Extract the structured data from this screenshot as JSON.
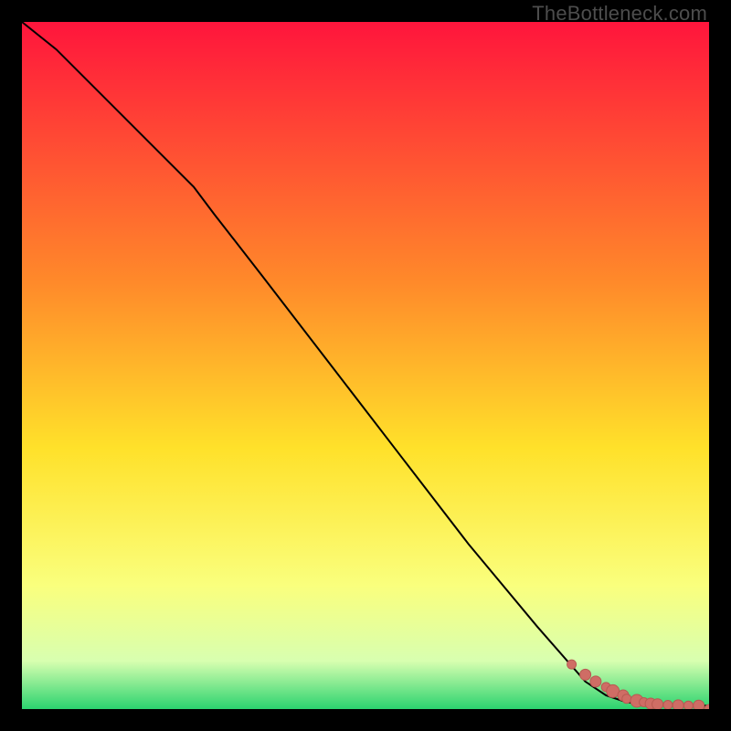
{
  "watermark": "TheBottleneck.com",
  "colors": {
    "bg": "#000000",
    "grad_top": "#ff153c",
    "grad_mid1": "#ff8a2a",
    "grad_mid2": "#ffe12a",
    "grad_mid3": "#faff7d",
    "grad_mid4": "#d8ffb0",
    "grad_bottom": "#2bd36f",
    "line": "#000000",
    "dot_fill": "#cf6d65",
    "dot_stroke": "#b85a52"
  },
  "chart_data": {
    "type": "line",
    "title": "",
    "xlabel": "",
    "ylabel": "",
    "xlim": [
      0,
      100
    ],
    "ylim": [
      0,
      100
    ],
    "series": [
      {
        "name": "curve",
        "x": [
          0,
          5,
          10,
          15,
          20,
          25,
          28,
          35,
          45,
          55,
          65,
          75,
          82,
          85,
          88,
          92,
          95,
          98,
          100
        ],
        "y": [
          100,
          96,
          91,
          86,
          81,
          76,
          72,
          63,
          50,
          37,
          24,
          12,
          4,
          2,
          1,
          0.6,
          0.5,
          0.5,
          0.5
        ]
      }
    ],
    "scatter": {
      "name": "dots",
      "x": [
        80,
        82,
        83.5,
        85,
        86,
        87.5,
        88,
        89.5,
        90.5,
        91.5,
        92.5,
        94,
        95.5,
        97,
        98.5,
        100
      ],
      "y": [
        6.5,
        5.0,
        4.0,
        3.2,
        2.6,
        2.0,
        1.5,
        1.2,
        1.0,
        0.8,
        0.7,
        0.6,
        0.55,
        0.5,
        0.5,
        0.0
      ],
      "r": [
        5,
        6,
        6,
        5,
        7,
        6,
        5,
        7,
        5,
        6,
        6,
        5,
        6,
        5,
        6,
        5
      ]
    }
  }
}
